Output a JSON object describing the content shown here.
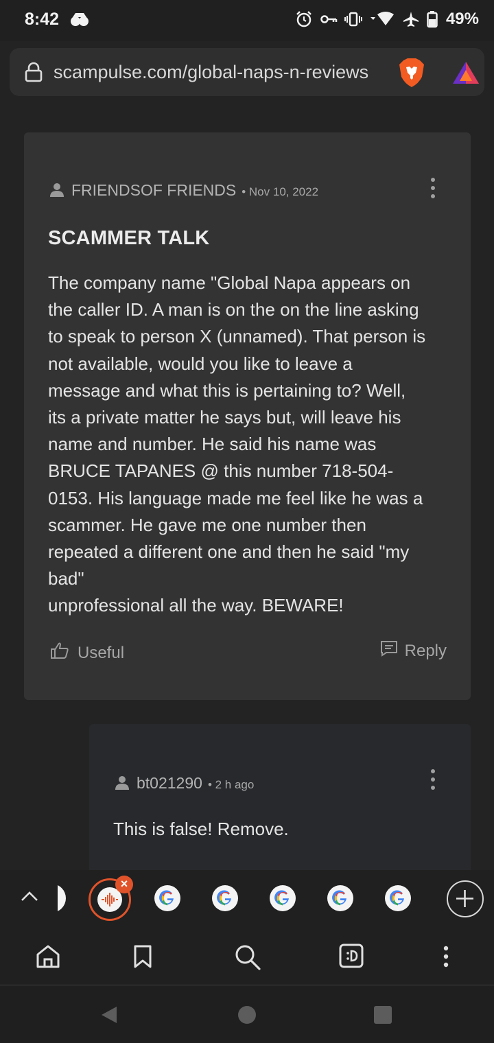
{
  "status_bar": {
    "time": "8:42",
    "battery": "49%"
  },
  "address_bar": {
    "url": "scampulse.com/global-naps-n-reviews"
  },
  "post": {
    "author": "FRIENDSOF FRIENDS",
    "date": "• Nov 10, 2022",
    "title": "SCAMMER TALK",
    "body_lines": [
      "The company name \"Global Napa appears on",
      "the caller ID. A man is on the on the line asking",
      "to speak to person X (unnamed). That person is",
      "not available, would you like to leave a",
      "message and what this is pertaining to? Well,",
      "its a private matter he says but, will leave his",
      "name and number. He said his name was",
      "BRUCE TAPANES @ this number 718-504-",
      "0153. His language made me feel like he was a",
      "scammer. He gave me one number then",
      "repeated a different one and then he said \"my",
      "bad\"",
      "unprofessional all the way. BEWARE!"
    ],
    "useful_label": "Useful",
    "reply_label": "Reply"
  },
  "reply": {
    "author": "bt021290",
    "time": "• 2 h ago",
    "text": "This is false! Remove."
  },
  "tab_strip": {
    "close_glyph": "×"
  },
  "colors": {
    "accent": "#e0532a",
    "card": "#333333",
    "reply_card": "#27292c"
  }
}
